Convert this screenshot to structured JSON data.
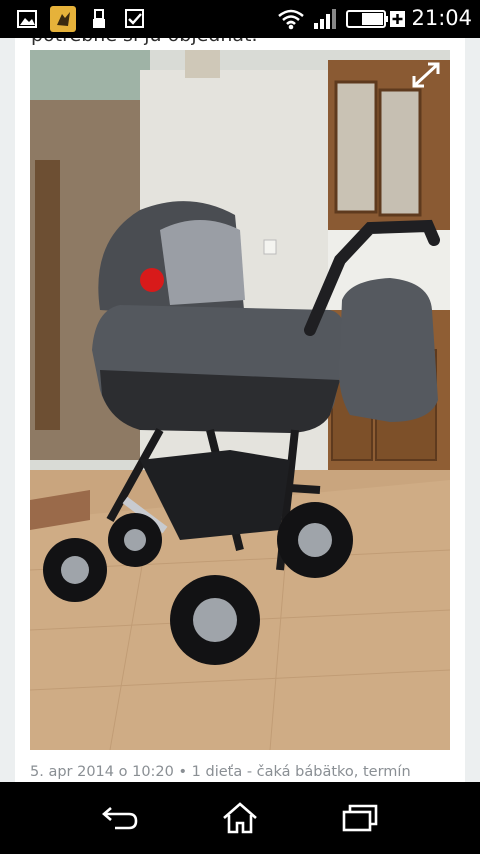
{
  "status_bar": {
    "time": "21:04",
    "icons": [
      "gallery-icon",
      "app-notification-icon",
      "usb-icon",
      "checkbox-icon",
      "wifi-icon",
      "signal-icon",
      "battery-icon"
    ]
  },
  "post": {
    "cutoff_text": "potrebné si ju objednať.",
    "meta": "5. apr 2014 o 10:20  •  1 dieťa - čaká bábätko, termín"
  },
  "nav": {
    "icons": [
      "back-icon",
      "home-icon",
      "recent-apps-icon"
    ]
  },
  "colors": {
    "status_bar": "#000000",
    "nav_bar": "#000000",
    "page_bg": "#eceff0",
    "card_bg": "#ffffff",
    "meta_text": "#8a8f94"
  }
}
